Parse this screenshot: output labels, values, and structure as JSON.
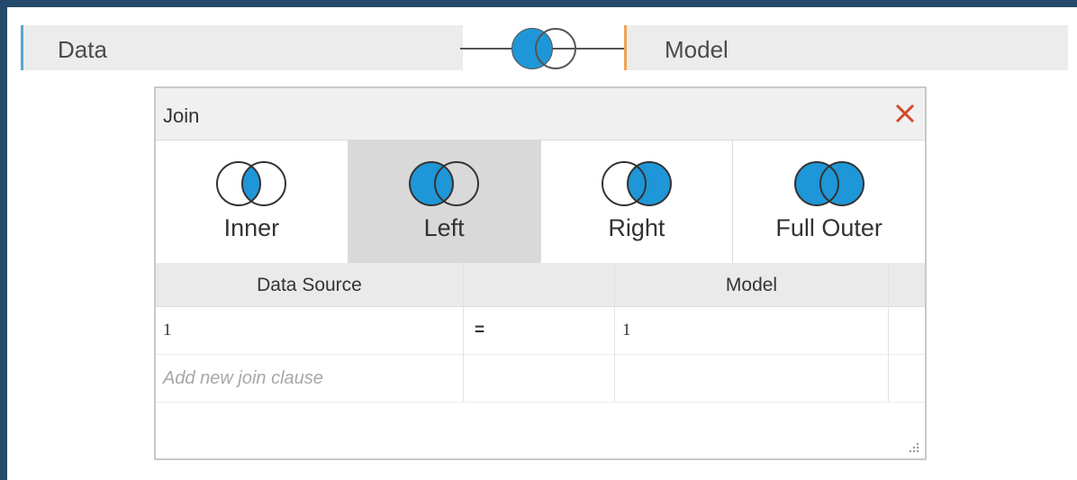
{
  "flow": {
    "left_table": "Data",
    "right_table": "Model",
    "left_accent": "#5aa6d2",
    "right_accent": "#f0a452",
    "join_icon": "left-join-icon"
  },
  "dialog": {
    "title": "Join",
    "close_icon": "close-icon",
    "join_types": [
      {
        "label": "Inner",
        "icon": "inner-join-icon",
        "selected": false
      },
      {
        "label": "Left",
        "icon": "left-join-icon",
        "selected": true
      },
      {
        "label": "Right",
        "icon": "right-join-icon",
        "selected": false
      },
      {
        "label": "Full Outer",
        "icon": "full-outer-join-icon",
        "selected": false
      }
    ],
    "columns": {
      "left": "Data Source",
      "operator": "",
      "right": "Model"
    },
    "clauses": [
      {
        "left": "1",
        "operator": "=",
        "right": "1"
      }
    ],
    "add_clause_placeholder": "Add new join clause"
  },
  "colors": {
    "venn_fill": "#1f96d7",
    "venn_stroke": "#333333",
    "close": "#d24a2c",
    "frame": "#24496a"
  }
}
